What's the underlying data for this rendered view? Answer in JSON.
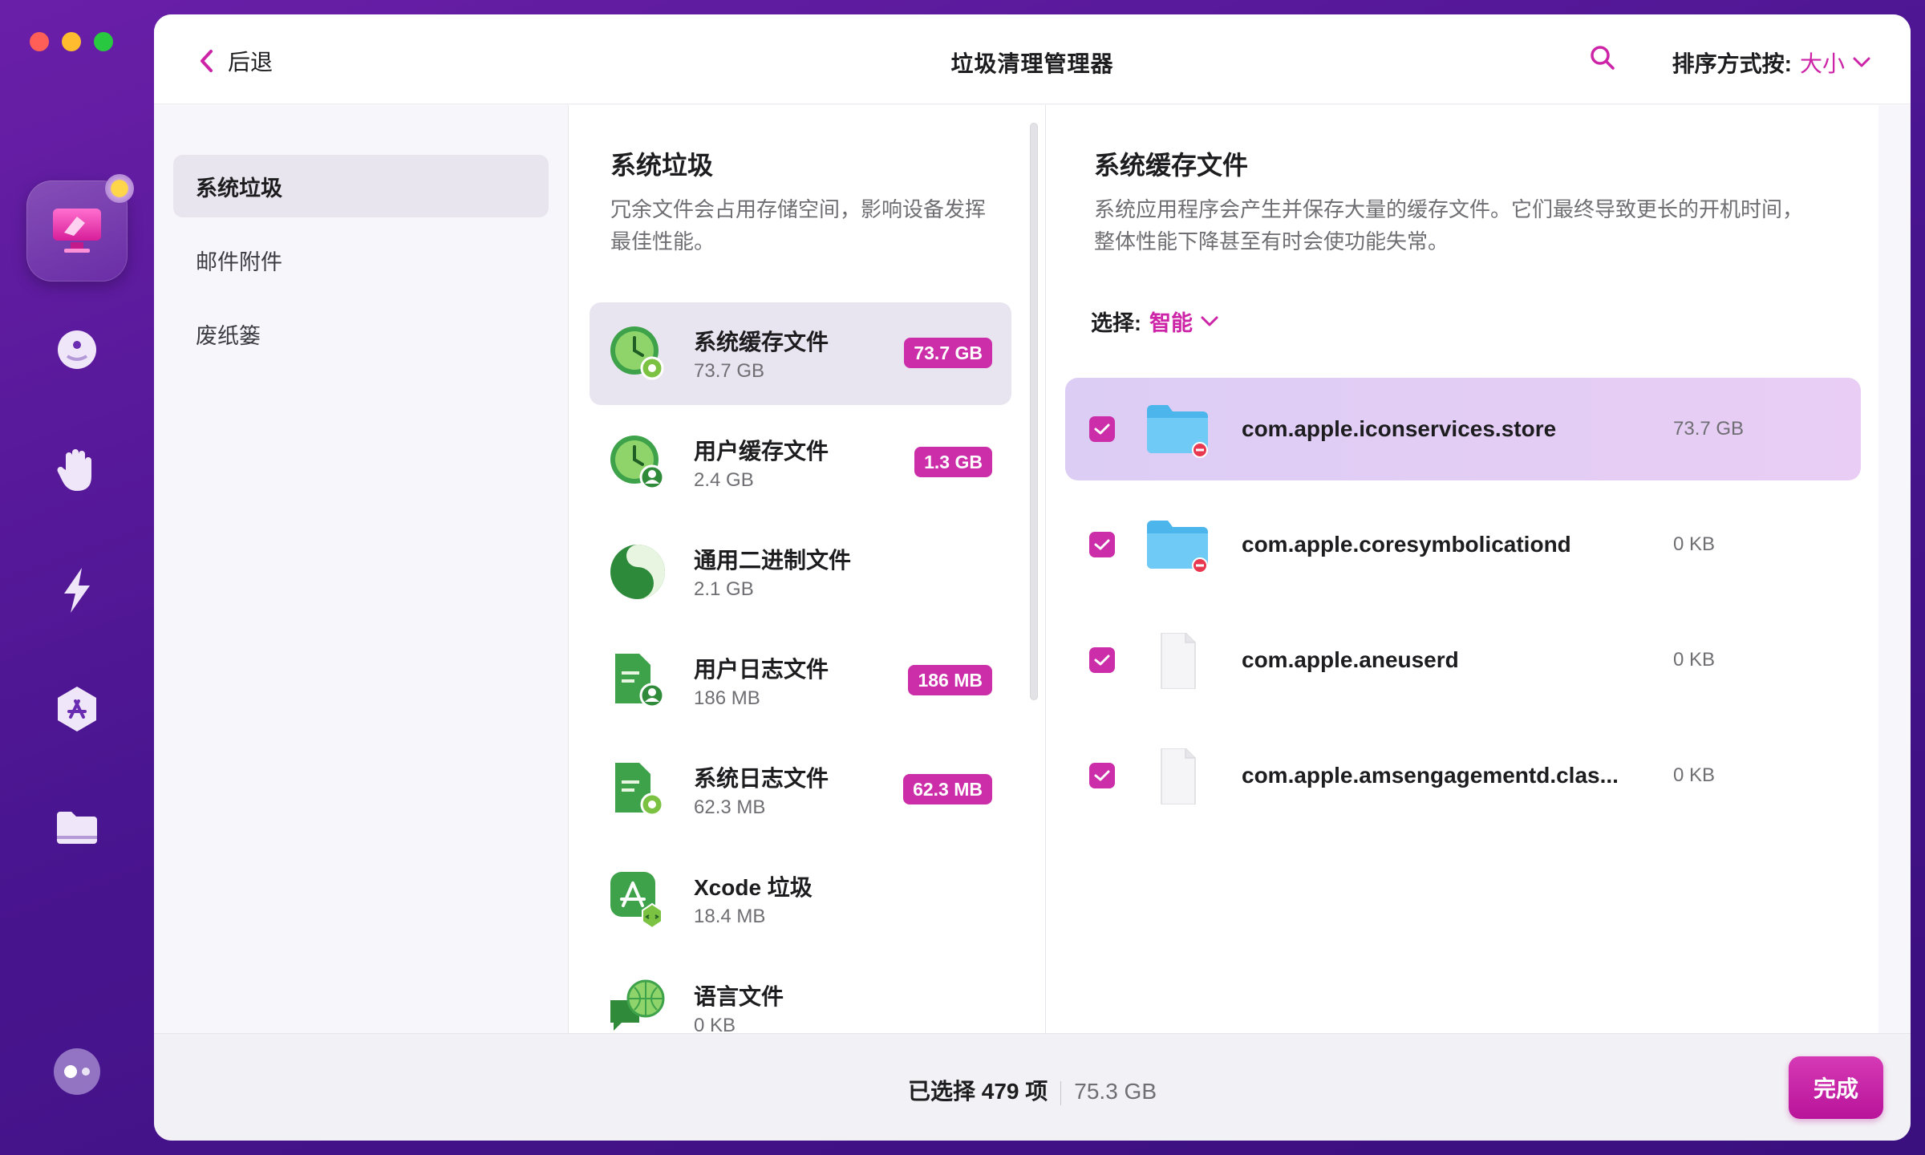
{
  "window": {
    "title": "垃圾清理管理器",
    "back_label": "后退",
    "sort_label": "排序方式按:",
    "sort_value": "大小"
  },
  "nav": {
    "items": [
      {
        "label": "系统垃圾"
      },
      {
        "label": "邮件附件"
      },
      {
        "label": "废纸篓"
      }
    ]
  },
  "categories": {
    "title": "系统垃圾",
    "description": "冗余文件会占用存储空间，影响设备发挥最佳性能。",
    "items": [
      {
        "name": "系统缓存文件",
        "size": "73.7 GB",
        "badge": "73.7 GB",
        "icon": "clock-gear-icon"
      },
      {
        "name": "用户缓存文件",
        "size": "2.4 GB",
        "badge": "1.3 GB",
        "icon": "clock-user-icon"
      },
      {
        "name": "通用二进制文件",
        "size": "2.1 GB",
        "badge": "",
        "icon": "binary-icon"
      },
      {
        "name": "用户日志文件",
        "size": "186 MB",
        "badge": "186 MB",
        "icon": "doc-user-icon"
      },
      {
        "name": "系统日志文件",
        "size": "62.3 MB",
        "badge": "62.3 MB",
        "icon": "doc-gear-icon"
      },
      {
        "name": "Xcode 垃圾",
        "size": "18.4 MB",
        "badge": "",
        "icon": "xcode-icon"
      },
      {
        "name": "语言文件",
        "size": "0 KB",
        "badge": "",
        "icon": "globe-chat-icon"
      }
    ]
  },
  "detail": {
    "title": "系统缓存文件",
    "description": "系统应用程序会产生并保存大量的缓存文件。它们最终导致更长的开机时间，整体性能下降甚至有时会使功能失常。",
    "select_label": "选择:",
    "select_value": "智能",
    "files": [
      {
        "name": "com.apple.iconservices.store",
        "size": "73.7 GB",
        "icon": "folder-icon",
        "checked": true
      },
      {
        "name": "com.apple.coresymbolicationd",
        "size": "0 KB",
        "icon": "folder-icon",
        "checked": true
      },
      {
        "name": "com.apple.aneuserd",
        "size": "0 KB",
        "icon": "file-icon",
        "checked": true
      },
      {
        "name": "com.apple.amsengagementd.clas...",
        "size": "0 KB",
        "icon": "file-icon",
        "checked": true
      }
    ]
  },
  "footer": {
    "selected": "已选择 479 项",
    "total": "75.3 GB",
    "done_label": "完成"
  },
  "colors": {
    "accent": "#cc2da8",
    "background": "#4a1590"
  }
}
